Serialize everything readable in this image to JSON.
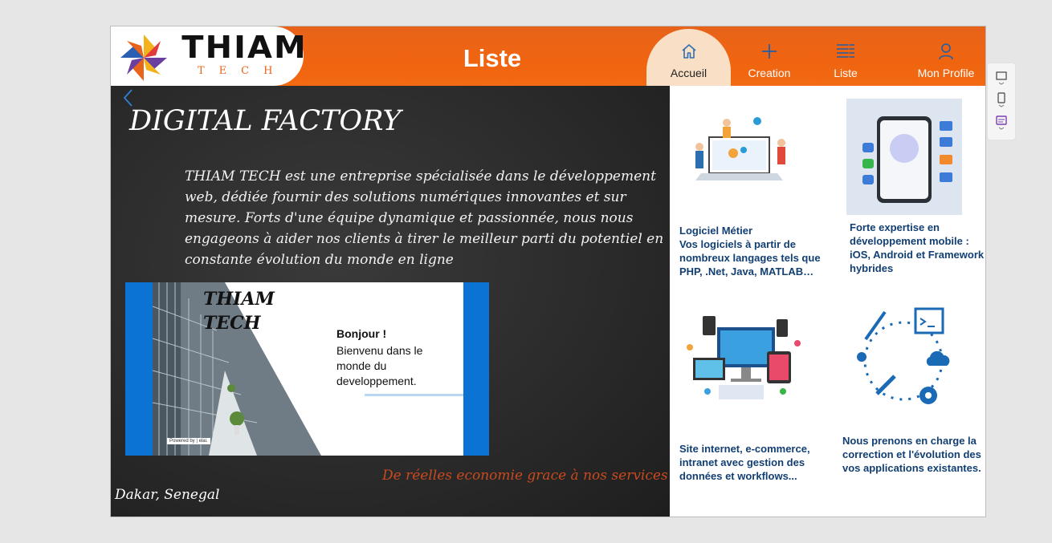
{
  "header": {
    "logo_text": "THIAM",
    "logo_sub": "TECH",
    "page_title": "Liste",
    "nav": [
      {
        "label": "Accueil",
        "icon": "home-icon",
        "active": true
      },
      {
        "label": "Creation",
        "icon": "plus-icon",
        "active": false
      },
      {
        "label": "Liste",
        "icon": "list-icon",
        "active": false
      },
      {
        "label": "Mon Profile",
        "icon": "user-icon",
        "active": false
      }
    ]
  },
  "hero": {
    "title": "DIGITAL FACTORY",
    "description": "THIAM TECH est une entreprise spécialisée dans le développement web, dédiée fournir des solutions numériques innovantes et sur mesure. Forts d'une équipe dynamique et passionnée, nous nous engageons à aider nos clients à tirer le meilleur parti du potentiel en constante évolution du monde en ligne",
    "tagline": "De réelles economie grace à nos services",
    "location": "Dakar, Senegal"
  },
  "media": {
    "logo_line1": "THIAM",
    "logo_line2": "TECH",
    "hello": "Bonjour !",
    "message": "Bienvenu dans le monde du developpement.",
    "powered": "Powered by | elai."
  },
  "cards": [
    {
      "title": "Logiciel Métier",
      "text": "Vos logiciels à partir de nombreux langages tels que PHP, .Net, Java, MATLAB…"
    },
    {
      "title": "",
      "text": "Forte expertise en développement mobile : iOS, Android et Framework hybrides"
    },
    {
      "title": "",
      "text": "Site internet, e-commerce, intranet avec gestion des données et workflows..."
    },
    {
      "title": "",
      "text": "Nous prenons en charge la correction et l'évolution des vos applications existantes."
    }
  ],
  "colors": {
    "header_orange": "#f06410",
    "active_tab": "#f8dfc5",
    "frame_blue": "#0b73d4",
    "card_text": "#123f73",
    "tagline": "#c84a1f"
  }
}
